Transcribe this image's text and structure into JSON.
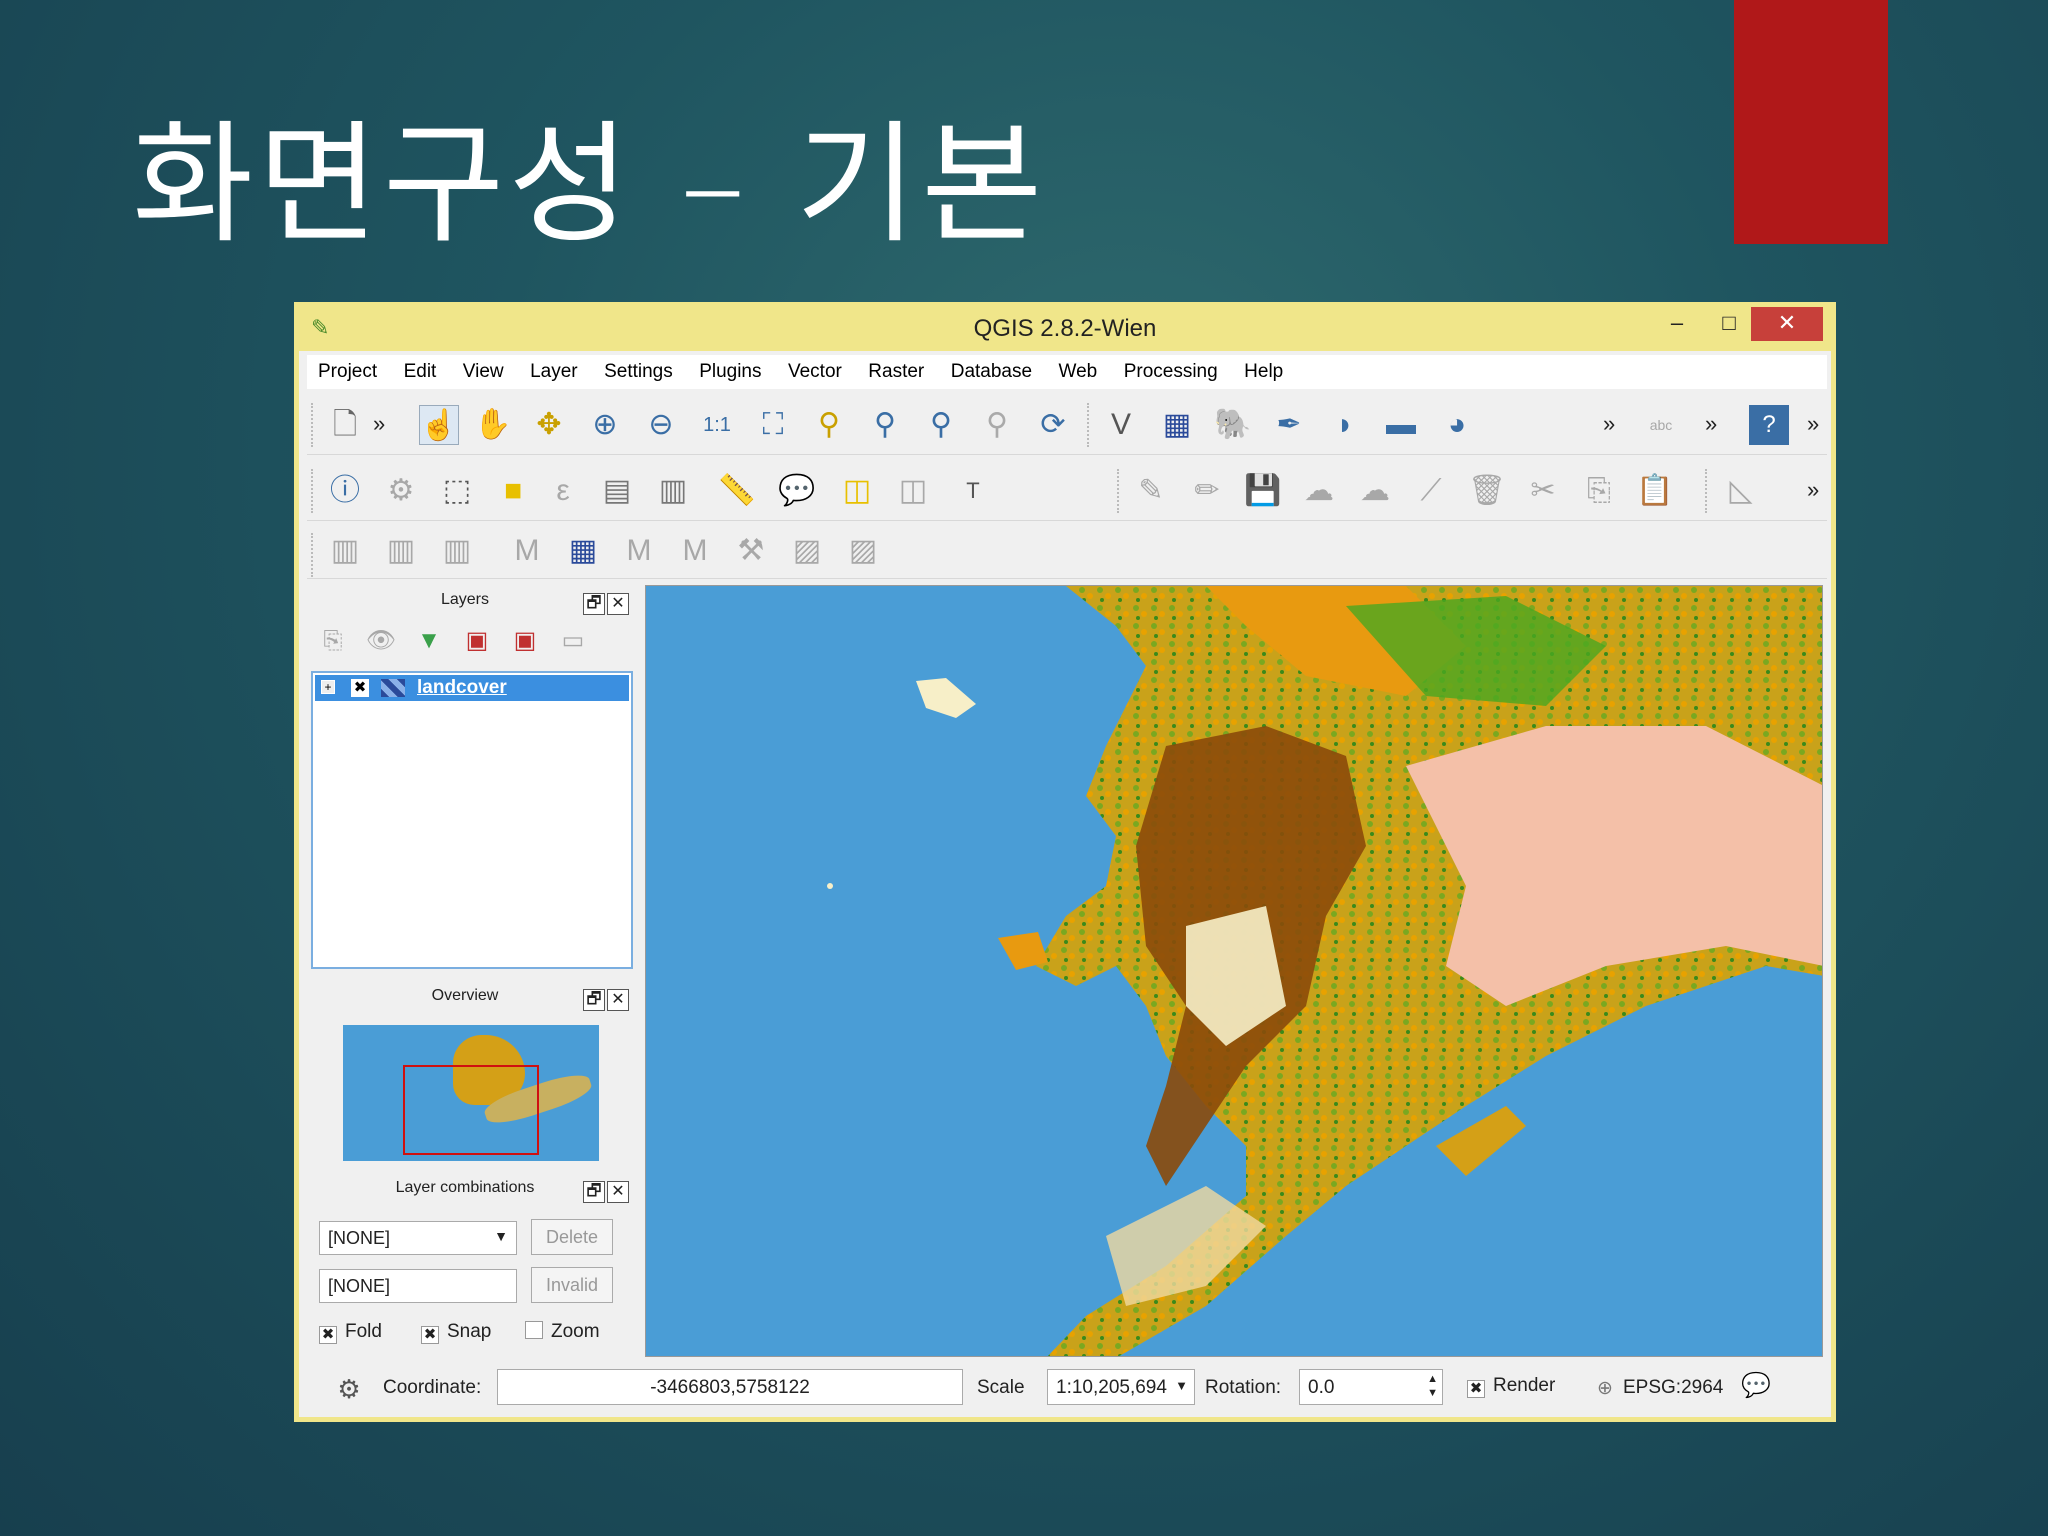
{
  "slide": {
    "title": "화면구성 – 기본"
  },
  "window": {
    "title": "QGIS 2.8.2-Wien",
    "minimize": "–",
    "maximize": "□",
    "close": "✕"
  },
  "menu": [
    "Project",
    "Edit",
    "View",
    "Layer",
    "Settings",
    "Plugins",
    "Vector",
    "Raster",
    "Database",
    "Web",
    "Processing",
    "Help"
  ],
  "panels": {
    "layers": {
      "title": "Layers",
      "items": [
        {
          "name": "landcover",
          "checked": "✖",
          "expand": "+"
        }
      ]
    },
    "overview": {
      "title": "Overview"
    },
    "combinations": {
      "title": "Layer combinations",
      "combo_value": "[NONE]",
      "text_value": "[NONE]",
      "delete_label": "Delete",
      "invalid_label": "Invalid",
      "fold_label": "Fold",
      "snap_label": "Snap",
      "zoom_label": "Zoom",
      "fold_mark": "✖",
      "snap_mark": "✖",
      "zoom_mark": ""
    },
    "float_icon": "🗗",
    "close_icon": "✕"
  },
  "status": {
    "coordinate_label": "Coordinate:",
    "coordinate_value": "-3466803,5758122",
    "scale_label": "Scale",
    "scale_value": "1:10,205,694",
    "rotation_label": "Rotation:",
    "rotation_value": "0.0",
    "render_label": "Render",
    "render_mark": "✖",
    "crs_label": "EPSG:2964"
  },
  "colors": {
    "water": "#4a9dd6",
    "titlebar": "#f0e68a",
    "accent_red": "#b01819",
    "selection": "#3b8fe0"
  }
}
